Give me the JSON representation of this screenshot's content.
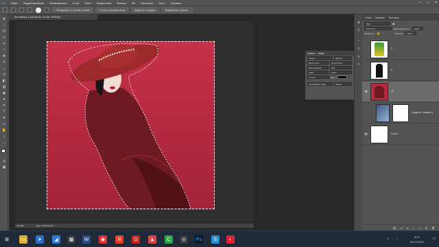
{
  "menubar": {
    "items": [
      "Файл",
      "Редактирование",
      "Изображение",
      "Слои",
      "Текст",
      "Выделение",
      "Фильтр",
      "3D",
      "Просмотр",
      "Окно",
      "Справка"
    ],
    "window_controls": [
      "—",
      "□",
      "✕"
    ]
  },
  "options": {
    "zoom_all_windows": "Объединить со всеми слоями",
    "auto_enhance": "Усилить автоматически",
    "refine_edge": "Выделить предмет",
    "select_and_mask": "Выделение и маска..."
  },
  "document": {
    "tab_title": "Без имени-1.psd @ 51,1% (Ы, RGB/8) *",
    "status_zoom": "51,09%",
    "status_doc": "Док: 2,86М/16,7М"
  },
  "character_panel": {
    "tabs": [
      "Символ",
      "Абзац"
    ],
    "font_family": "Impact",
    "font_style": "Regular",
    "font_size": "68,24 пункт",
    "leading": "52,02 пункт",
    "tracking_label": "Метрические",
    "tracking_value": "200",
    "scale_v": "100%",
    "scale_h": "100%",
    "baseline": "0 пункт",
    "color_label": "Цвет:",
    "language": "Английский: США",
    "aa": "Резкое"
  },
  "layers_panel": {
    "tabs": [
      "Слои",
      "Каналы",
      "Контуры"
    ],
    "filter_label": "Вид",
    "blend_mode": "Обычные",
    "opacity_label": "Непрозрачность:",
    "opacity_value": "100%",
    "lock_label": "Закрепить:",
    "fill_label": "Заливка:",
    "fill_value": "100%",
    "layers": [
      {
        "name": "3"
      },
      {
        "name": "6"
      },
      {
        "name": "2е"
      },
      {
        "name": "Градиент. заливка 1"
      },
      {
        "name": "Слой 1"
      }
    ]
  },
  "taskbar": {
    "time": "8:17",
    "date": "05.12.2021"
  },
  "colors": {
    "artboard_top": "#c63148",
    "dress": "#6e1a22",
    "hat": "#9c2a2c"
  }
}
